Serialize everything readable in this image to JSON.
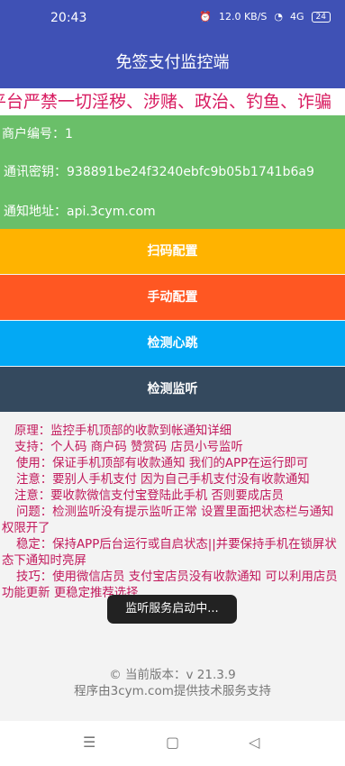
{
  "status_bar": {
    "time": "20:43",
    "icons": [
      "alarm-icon",
      "speed-icon",
      "wifi-icon",
      "hd-icon",
      "signal-icon"
    ],
    "speed": "12.0 KB/S",
    "network": "4G",
    "battery": "24"
  },
  "app_bar": {
    "title": "免签支付监控端"
  },
  "notice": {
    "text": "平台严禁一切淫秽、涉赌、政治、钓鱼、诈骗"
  },
  "info": {
    "merchant_id": "商户编号：1",
    "secret_key": "通讯密钥：938891be24f3240ebfc9b05b1741b6a9",
    "notify_url": "通知地址：api.3cym.com"
  },
  "buttons": {
    "scan_config": "扫码配置",
    "manual_config": "手动配置",
    "heartbeat": "检测心跳",
    "monitor": "检测监听"
  },
  "description": [
    "原理：监控手机顶部的收款到帐通知详细",
    "支持：个人码 商户码 赞赏码 店员小号监听",
    "使用：保证手机顶部有收款通知 我们的APP在运行即可",
    "注意：要别人手机支付 因为自己手机支付没有收款通知",
    "注意：要收款微信支付宝登陆此手机 否则要成店员",
    "问题：检测监听没有提示监听正常 设置里面把状态栏与通知权限开了",
    "稳定：保持APP后台运行或自启状态||并要保持手机在锁屏状态下通知时亮屏",
    "技巧：使用微信店员 支付宝店员没有收款通知 可以利用店员功能更新 更稳定推荐选择"
  ],
  "footer": {
    "version": "© 当前版本：v 21.3.9",
    "support": "程序由3cym.com提供技术服务支持"
  },
  "toast": {
    "text": "监听服务启动中..."
  },
  "nav_bar": {
    "icons": [
      "menu-icon",
      "home-icon",
      "back-icon"
    ]
  }
}
